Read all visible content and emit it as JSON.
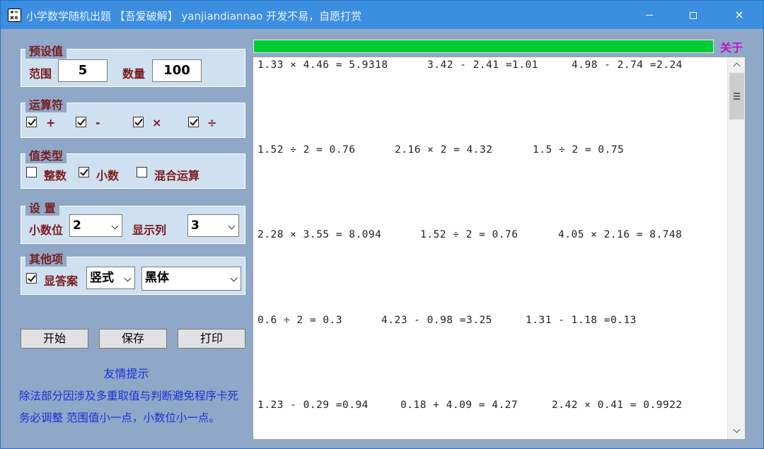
{
  "window": {
    "title": "小学数学随机出题 【吾爱破解】 yanjiandiannao 开发不易，自愿打赏",
    "controls": [
      "minimize",
      "maximize",
      "close"
    ],
    "close_glyph": "×"
  },
  "preset": {
    "legend": "预设值",
    "range_label": "范围",
    "range_value": "5",
    "count_label": "数量",
    "count_value": "100"
  },
  "operators": {
    "legend": "运算符",
    "items": [
      {
        "symbol": "+",
        "checked": true
      },
      {
        "symbol": "-",
        "checked": true
      },
      {
        "symbol": "×",
        "checked": true
      },
      {
        "symbol": "÷",
        "checked": true
      }
    ]
  },
  "value_type": {
    "legend": "值类型",
    "items": [
      {
        "label": "整数",
        "checked": false
      },
      {
        "label": "小数",
        "checked": true
      },
      {
        "label": "混合运算",
        "checked": false
      }
    ]
  },
  "settings": {
    "legend": "设 置",
    "decimal_label": "小数位",
    "decimal_value": "2",
    "columns_label": "显示列",
    "columns_value": "3"
  },
  "other": {
    "legend": "其他项",
    "show_answer_label": "显答案",
    "show_answer_checked": true,
    "layout_value": "竖式",
    "font_value": "黑体"
  },
  "buttons": {
    "start": "开始",
    "save": "保存",
    "print": "打印"
  },
  "hint": {
    "title": "友情提示",
    "line1": "除法部分因涉及多重取值与判断避免程序卡死",
    "line2": "务必调整 范围值小一点，小数位小一点。"
  },
  "about_label": "关于",
  "progress_percent": 100,
  "colors": {
    "titlebar": "#3c8ee0",
    "panel_bg": "#8fa8c7",
    "group_bg": "#cfe0f0",
    "label_red": "#7a1a1a",
    "hint_blue": "#1a2fd8",
    "progress_green": "#00cc33",
    "about_magenta": "#c014c0"
  },
  "results": [
    [
      "1.33 × 4.46 = 5.9318",
      "3.42 - 2.41 =1.01",
      "4.98 - 2.74 =2.24"
    ],
    [
      "1.52 ÷ 2 = 0.76",
      "2.16 × 2 = 4.32",
      "1.5 ÷ 2 = 0.75"
    ],
    [
      "2.28 × 3.55 = 8.094",
      "1.52 ÷ 2 = 0.76",
      "4.05 × 2.16 = 8.748"
    ],
    [
      "0.6 ÷ 2 = 0.3",
      "4.23 - 0.98 =3.25",
      "1.31 - 1.18 =0.13"
    ],
    [
      "1.23 - 0.29 =0.94",
      "0.18 + 4.09 = 4.27",
      "2.42 × 0.41 = 0.9922"
    ]
  ]
}
